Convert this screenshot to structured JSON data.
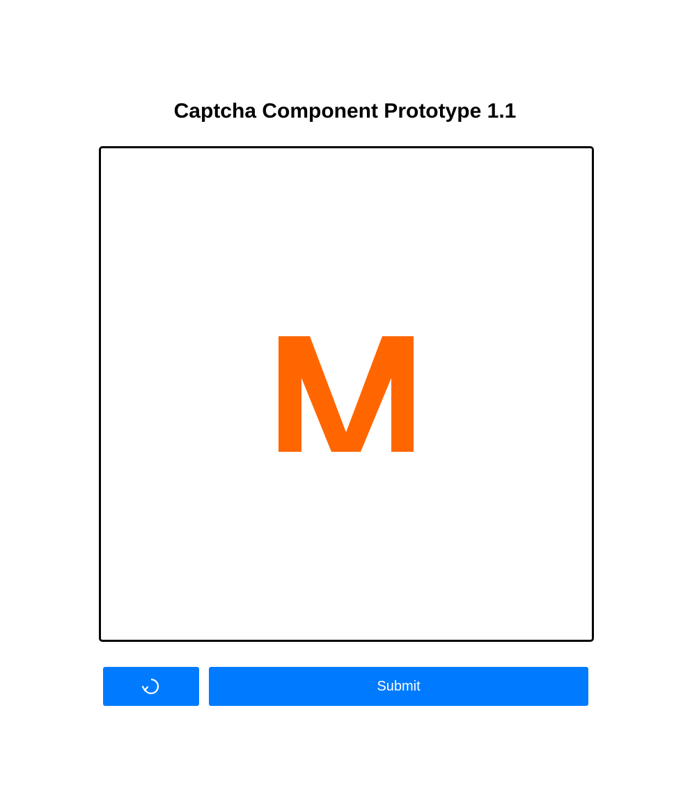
{
  "header": {
    "title": "Captcha Component Prototype 1.1"
  },
  "captcha": {
    "character": "M",
    "character_color": "#ff6600",
    "border_color": "#000000"
  },
  "controls": {
    "refresh_icon": "refresh-icon",
    "submit_label": "Submit",
    "button_color": "#007bff"
  }
}
